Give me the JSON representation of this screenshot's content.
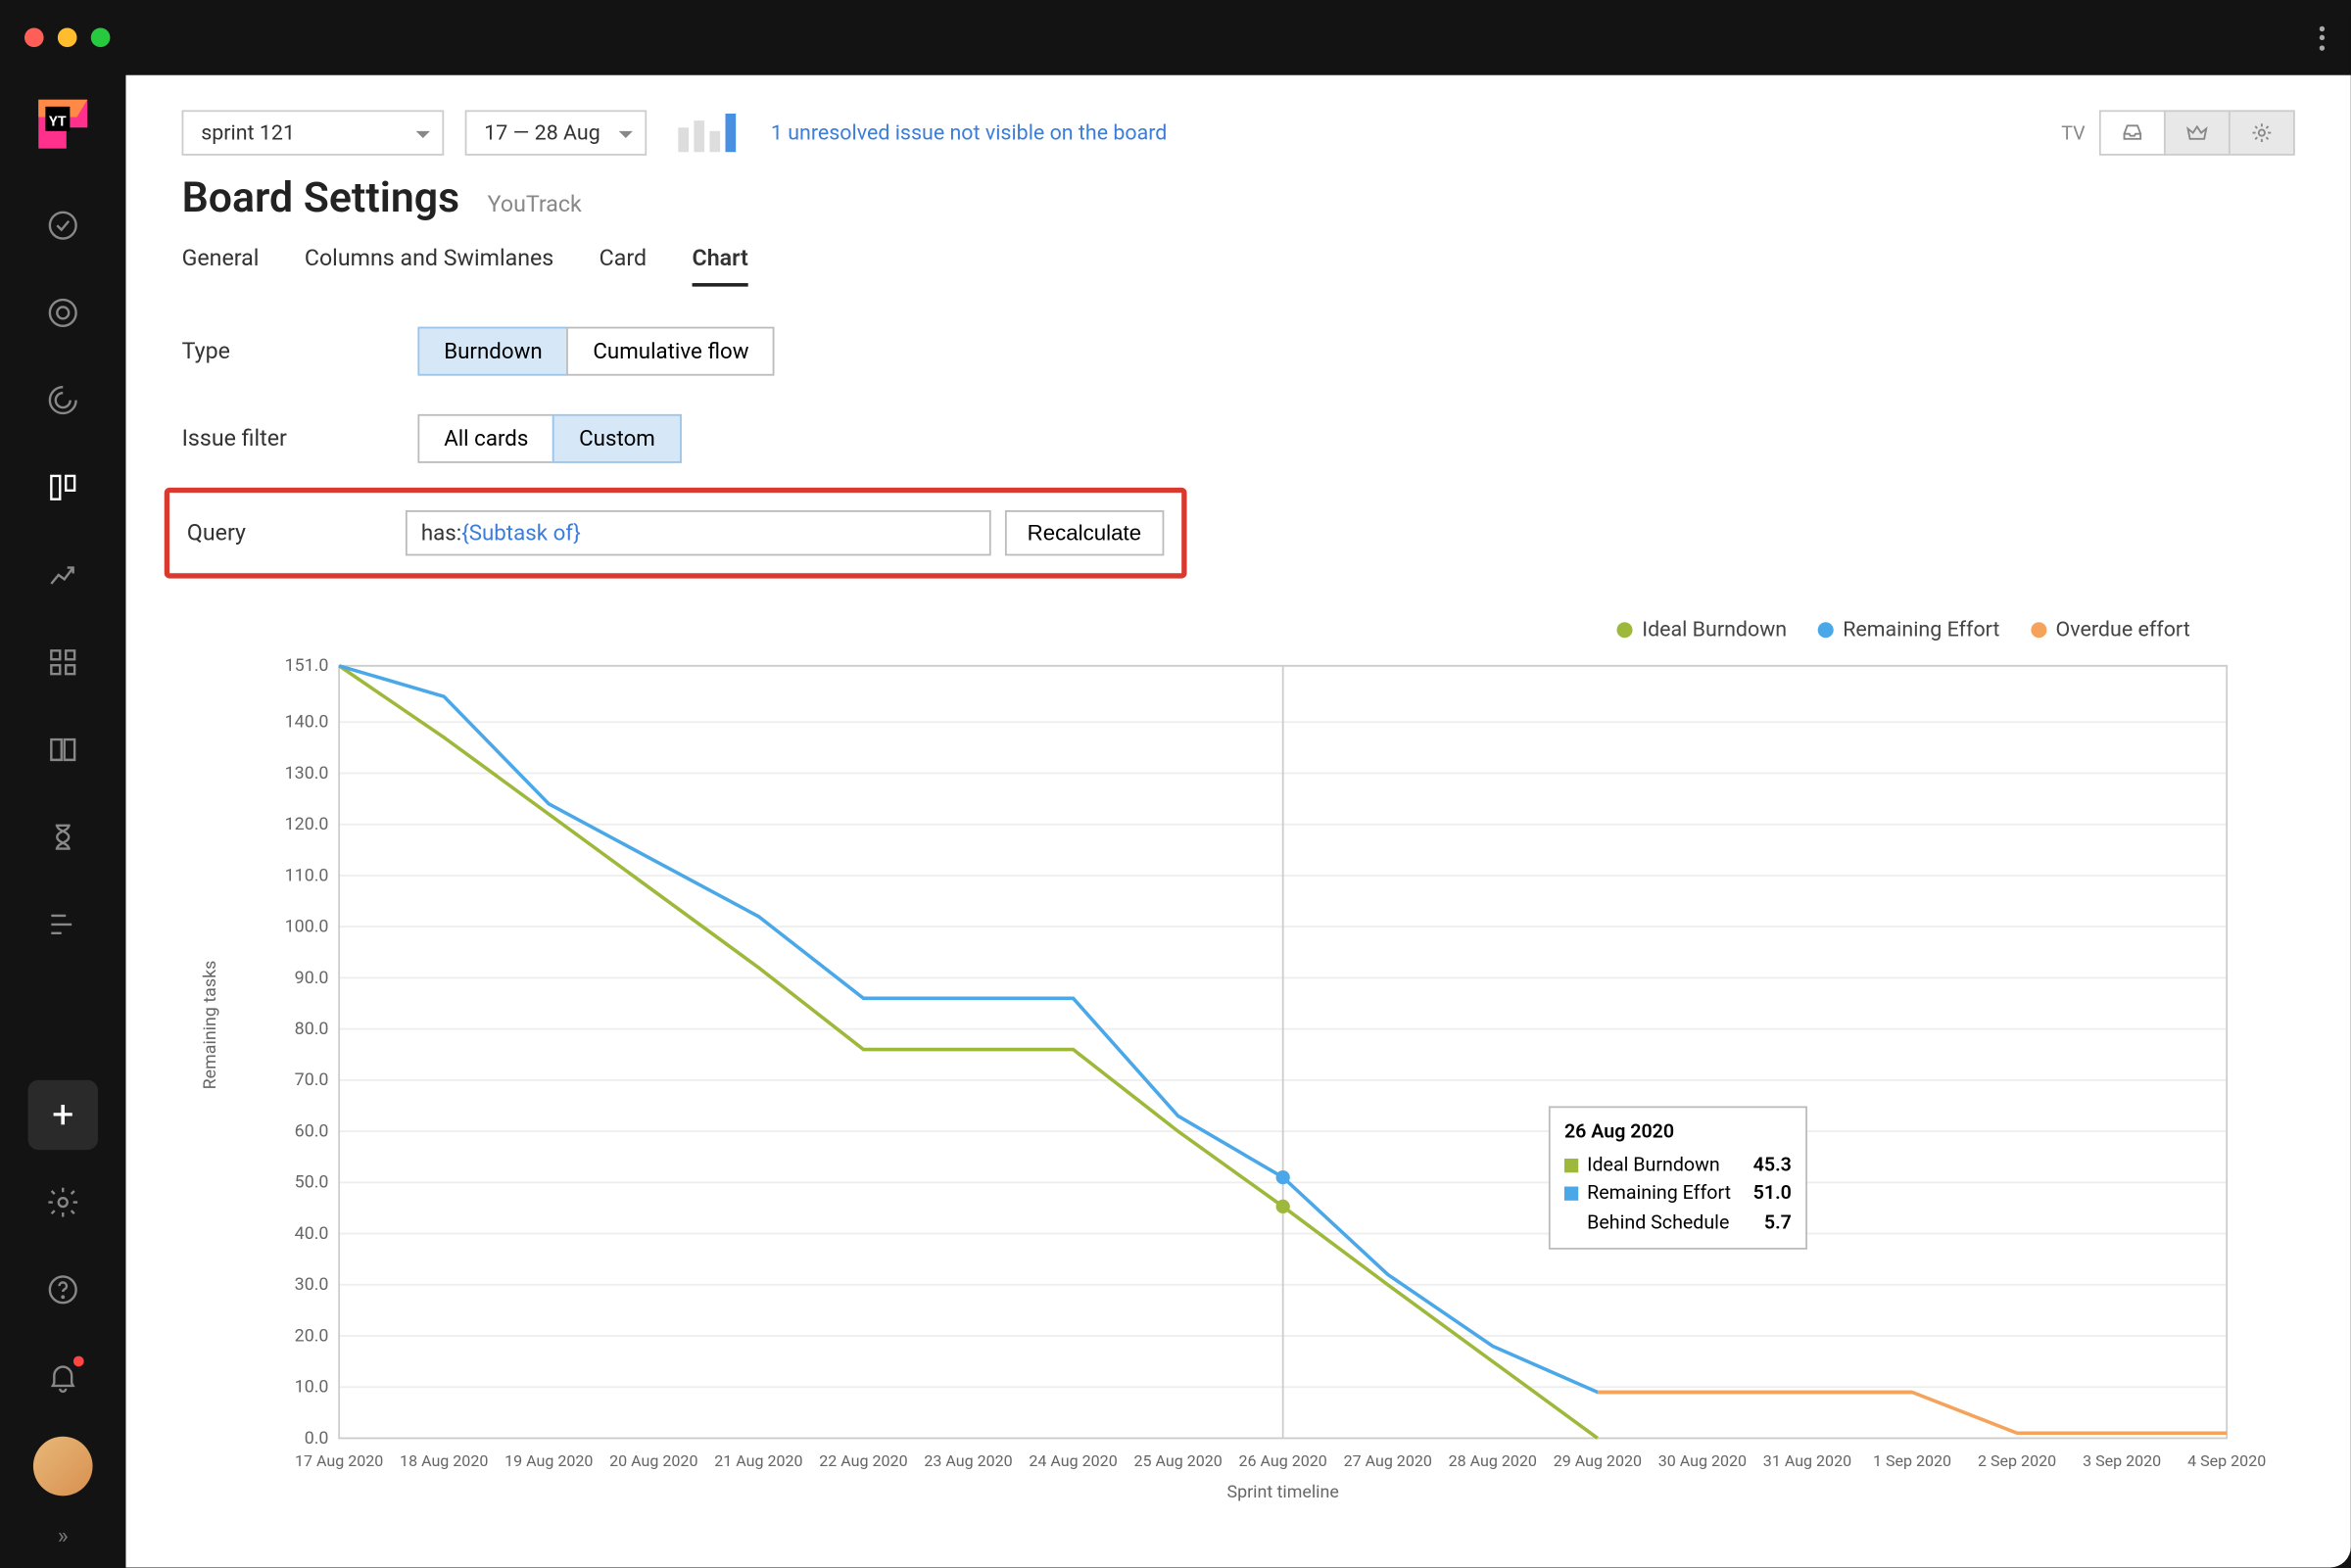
{
  "header": {
    "sprint": "sprint 121",
    "daterange": "17 — 28 Aug",
    "warning": "1 unresolved issue not visible on the board",
    "tv": "TV"
  },
  "page": {
    "title": "Board Settings",
    "subtitle": "YouTrack"
  },
  "tabs": [
    "General",
    "Columns and Swimlanes",
    "Card",
    "Chart"
  ],
  "activeTab": "Chart",
  "form": {
    "typeLabel": "Type",
    "typeOptions": [
      "Burndown",
      "Cumulative flow"
    ],
    "typeSelected": "Burndown",
    "filterLabel": "Issue filter",
    "filterOptions": [
      "All cards",
      "Custom"
    ],
    "filterSelected": "Custom",
    "queryLabel": "Query",
    "queryPrefix": "has: ",
    "queryToken": "{Subtask of}",
    "recalcLabel": "Recalculate"
  },
  "legend": {
    "ideal": "Ideal Burndown",
    "remaining": "Remaining Effort",
    "overdue": "Overdue effort"
  },
  "tooltip": {
    "date": "26 Aug 2020",
    "rows": [
      {
        "label": "Ideal Burndown",
        "value": "45.3",
        "color": "#9eb83b"
      },
      {
        "label": "Remaining Effort",
        "value": "51.0",
        "color": "#4aa8e8"
      },
      {
        "label": "Behind Schedule",
        "value": "5.7",
        "color": ""
      }
    ]
  },
  "ylabel": "Remaining tasks",
  "xlabel": "Sprint timeline",
  "chart_data": {
    "type": "line",
    "xlabel": "Sprint timeline",
    "ylabel": "Remaining tasks",
    "ylim": [
      0,
      151
    ],
    "y_ticks": [
      0,
      10,
      20,
      30,
      40,
      50,
      60,
      70,
      80,
      90,
      100,
      110,
      120,
      130,
      140,
      151
    ],
    "categories": [
      "17 Aug 2020",
      "18 Aug 2020",
      "19 Aug 2020",
      "20 Aug 2020",
      "21 Aug 2020",
      "22 Aug 2020",
      "23 Aug 2020",
      "24 Aug 2020",
      "25 Aug 2020",
      "26 Aug 2020",
      "27 Aug 2020",
      "28 Aug 2020",
      "29 Aug 2020",
      "30 Aug 2020",
      "31 Aug 2020",
      "1 Sep 2020",
      "2 Sep 2020",
      "3 Sep 2020",
      "4 Sep 2020"
    ],
    "series": [
      {
        "name": "Ideal Burndown",
        "color": "#9eb83b",
        "values": [
          151,
          137,
          122,
          107,
          92,
          76,
          76,
          76,
          60,
          45.3,
          30,
          15,
          0,
          null,
          null,
          null,
          null,
          null,
          null
        ]
      },
      {
        "name": "Remaining Effort",
        "color": "#4aa8e8",
        "values": [
          151,
          145,
          124,
          113,
          102,
          86,
          86,
          86,
          63,
          51,
          32,
          18,
          9,
          9,
          9,
          9,
          null,
          null,
          null
        ]
      },
      {
        "name": "Overdue effort",
        "color": "#f5a25a",
        "values": [
          null,
          null,
          null,
          null,
          null,
          null,
          null,
          null,
          null,
          null,
          null,
          null,
          9,
          9,
          9,
          9,
          1,
          1,
          1
        ]
      }
    ],
    "highlight_point": {
      "x": "26 Aug 2020",
      "ideal": 45.3,
      "remaining": 51.0,
      "behind": 5.7
    }
  }
}
